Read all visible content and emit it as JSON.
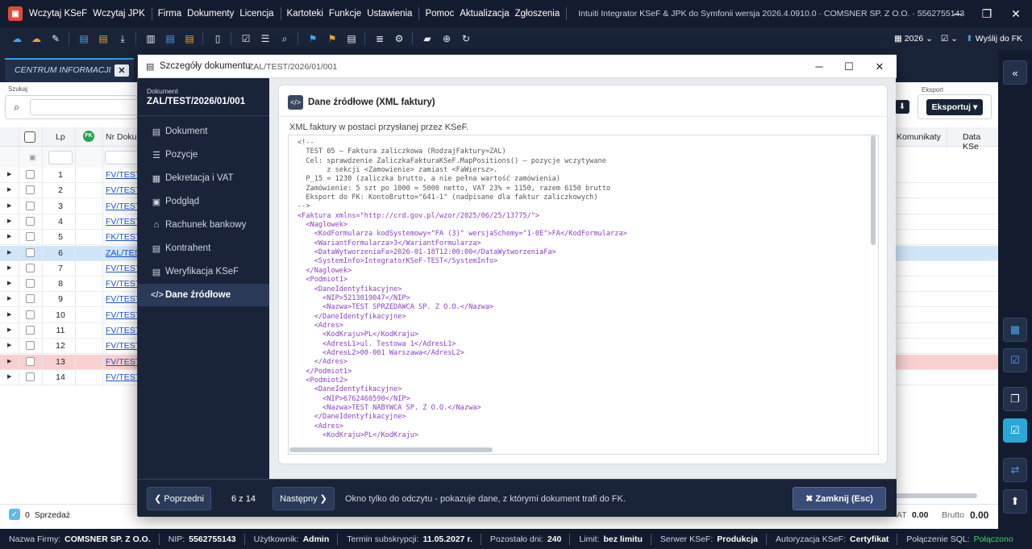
{
  "app": {
    "menu": [
      "Wczytaj KSeF",
      "Wczytaj JPK",
      "Firma",
      "Dokumenty",
      "Licencja",
      "Kartoteki",
      "Funkcje",
      "Ustawienia",
      "Pomoc",
      "Aktualizacja",
      "Zgłoszenia"
    ],
    "info": "Intuiti Integrator KSeF & JPK do Symfonii wersja 2026.4.0910.0 · COMSNER SP. Z O.O. · 5562755143"
  },
  "toolbar": {
    "year": "2026",
    "send_label": "Wyślij do FK"
  },
  "tab": {
    "label": "CENTRUM INFORMACJI"
  },
  "grid": {
    "search_label": "Szukaj",
    "headers": {
      "lp": "Lp",
      "fk": "FK",
      "nr": "Nr Doku",
      "komunikaty": "Komunikaty",
      "data": "Data KSe"
    },
    "rows": [
      {
        "lp": "1",
        "nr": "FV/TEST"
      },
      {
        "lp": "2",
        "nr": "FV/TEST"
      },
      {
        "lp": "3",
        "nr": "FV/TEST"
      },
      {
        "lp": "4",
        "nr": "FV/TEST"
      },
      {
        "lp": "5",
        "nr": "FK/TEST"
      },
      {
        "lp": "6",
        "nr": "ZAL/TEST"
      },
      {
        "lp": "7",
        "nr": "FV/TEST"
      },
      {
        "lp": "8",
        "nr": "FV/TEST"
      },
      {
        "lp": "9",
        "nr": "FV/TEST"
      },
      {
        "lp": "10",
        "nr": "FV/TEST"
      },
      {
        "lp": "11",
        "nr": "FV/TEST"
      },
      {
        "lp": "12",
        "nr": "FV/TEST"
      },
      {
        "lp": "13",
        "nr": "FV/TEST"
      },
      {
        "lp": "14",
        "nr": "FV/TEST"
      }
    ],
    "selected_row": 6,
    "error_row": 13,
    "export_label": "Eksport",
    "export_button": "Eksportuj"
  },
  "summary": {
    "count": "0",
    "label": "Sprzedaż",
    "vat_label": "AT",
    "vat_value": "0.00",
    "brutto_label": "Brutto",
    "brutto_value": "0.00"
  },
  "status": {
    "firma_label": "Nazwa Firmy:",
    "firma": "COMSNER SP. Z O.O.",
    "nip_label": "NIP:",
    "nip": "5562755143",
    "user_label": "Użytkownik:",
    "user": "Admin",
    "sub_label": "Termin subskrypcji:",
    "sub": "11.05.2027 r.",
    "days_label": "Pozostało dni:",
    "days": "240",
    "limit_label": "Limit:",
    "limit": "bez limitu",
    "server_label": "Serwer KSeF:",
    "server": "Produkcja",
    "auth_label": "Autoryzacja KSeF:",
    "auth": "Certyfikat",
    "sql_label": "Połączenie SQL:",
    "sql": "Połączono"
  },
  "modal": {
    "title": "Szczegóły dokumentu",
    "doc_path": "ZAL/TEST/2026/01/001",
    "doc_label": "Dokument",
    "doc_value": "ZAL/TEST/2026/01/001",
    "nav": [
      "Dokument",
      "Pozycje",
      "Dekretacja i VAT",
      "Podgląd",
      "Rachunek bankowy",
      "Kontrahent",
      "Weryfikacja KSeF",
      "Dane źródłowe"
    ],
    "active_nav": 7,
    "card_title": "Dane źródłowe (XML faktury)",
    "card_subtitle": "XML faktury w postaci przysłanej przez KSeF.",
    "xml": [
      "<!--",
      "  TEST 05 — Faktura zaliczkowa (RodzajFaktury=ZAL)",
      "  Cel: sprawdzenie ZaliczkaFakturaKSeF.MapPositions() — pozycje wczytywane",
      "       z sekcji <Zamowienie> zamiast <FaWiersz>.",
      "  P_15 = 1230 (zaliczka brutto, a nie pełna wartość zamówienia)",
      "  Zamówienie: 5 szt po 1000 = 5000 netto, VAT 23% = 1150, razem 6150 brutto",
      "  Eksport do FK: KontoBrutto=\"641-1\" (nadpisane dla faktur zaliczkowych)",
      "-->",
      "<Faktura xmlns=\"http://crd.gov.pl/wzor/2025/06/25/13775/\">",
      "  <Naglowek>",
      "    <KodFormularza kodSystemowy=\"FA (3)\" wersjaSchemy=\"1-0E\">FA</KodFormularza>",
      "    <WariantFormularza>3</WariantFormularza>",
      "    <DataWytworzeniaFa>2026-01-18T12:00:00</DataWytworzeniaFa>",
      "    <SystemInfo>IntegratorKSeF-TEST</SystemInfo>",
      "  </Naglowek>",
      "  <Podmiot1>",
      "    <DaneIdentyfikacyjne>",
      "      <NIP>5213019047</NIP>",
      "      <Nazwa>TEST SPRZEDAWCA SP. Z O.O.</Nazwa>",
      "    </DaneIdentyfikacyjne>",
      "    <Adres>",
      "      <KodKraju>PL</KodKraju>",
      "      <AdresL1>ul. Testowa 1</AdresL1>",
      "      <AdresL2>00-001 Warszawa</AdresL2>",
      "    </Adres>",
      "  </Podmiot1>",
      "  <Podmiot2>",
      "    <DaneIdentyfikacyjne>",
      "      <NIP>6762460590</NIP>",
      "      <Nazwa>TEST NABYWCA SP. Z O.O.</Nazwa>",
      "    </DaneIdentyfikacyjne>",
      "    <Adres>",
      "      <KodKraju>PL</KodKraju>"
    ],
    "prev_label": "Poprzedni",
    "pager": "6 z 14",
    "next_label": "Następny",
    "footer_info": "Okno tylko do odczytu - pokazuje dane, z którymi dokument trafi do FK.",
    "close_label": "Zamknij (Esc)"
  },
  "colors": {
    "dark": "#131c2e",
    "panel": "#1a2438",
    "accent": "#29a8d8",
    "selected": "#cfe6fa",
    "error": "#f8d0d0"
  }
}
